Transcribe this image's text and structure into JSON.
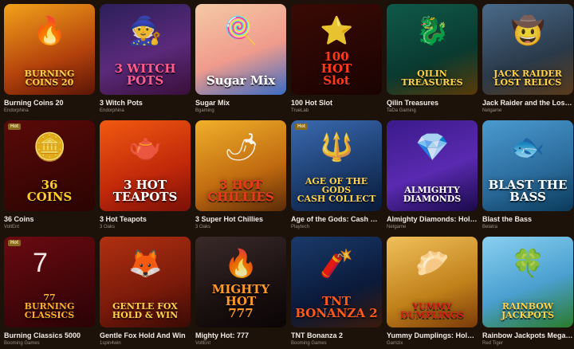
{
  "games": [
    {
      "title": "Burning Coins 20",
      "provider": "Endorphina",
      "art": "BURNING\nCOINS 20",
      "hot": "",
      "bg": "linear-gradient(160deg,#f3a21a,#b4420c 60%,#5a1506)",
      "text_color": "#ffd24a",
      "icon": "fire-icon",
      "glyph": "🔥"
    },
    {
      "title": "3 Witch Pots",
      "provider": "Endorphina",
      "art": "3 WITCH\nPOTS",
      "hot": "",
      "bg": "linear-gradient(160deg,#2b1f5a,#5b2a7a 55%,#3a0f3a)",
      "text_color": "#ff5a8a",
      "icon": "witch-hat-icon",
      "glyph": "🧙"
    },
    {
      "title": "Sugar Mix",
      "provider": "Bgaming",
      "art": "Sugar Mix",
      "hot": "",
      "bg": "linear-gradient(160deg,#f4c9a6,#f09b8c 55%,#3a6cc4)",
      "text_color": "#ffffff",
      "icon": "candy-icon",
      "glyph": "🍭"
    },
    {
      "title": "100 Hot Slot",
      "provider": "TrueLab",
      "art": "100\nHOT\nSlot",
      "hot": "",
      "bg": "linear-gradient(160deg,#3a0a05,#1a0302)",
      "text_color": "#ff3a1a",
      "icon": "star-icon",
      "glyph": "⭐"
    },
    {
      "title": "Qilin Treasures",
      "provider": "TaDa Gaming",
      "art": "QILIN\nTREASURES",
      "hot": "",
      "bg": "linear-gradient(160deg,#0f5a4a,#0a3a30 60%,#5a3a08)",
      "text_color": "#ffd24a",
      "icon": "dragon-icon",
      "glyph": "🐉"
    },
    {
      "title": "Jack Raider and the Lost Relics",
      "provider": "Netgame",
      "art": "JACK RAIDER\nLOST RELICS",
      "hot": "",
      "bg": "linear-gradient(160deg,#4a6a8a,#2a3a4a 60%,#5a3a1a)",
      "text_color": "#ffd24a",
      "icon": "explorer-icon",
      "glyph": "🤠"
    },
    {
      "title": "36 Coins",
      "provider": "VoltEnt",
      "art": "36\nCOINS",
      "hot": "Hot",
      "bg": "linear-gradient(160deg,#5a0a08,#2a0402)",
      "text_color": "#ffcc2a",
      "icon": "coin-icon",
      "glyph": "🪙"
    },
    {
      "title": "3 Hot Teapots",
      "provider": "3 Oaks",
      "art": "3 HOT\nTEAPOTS",
      "hot": "",
      "bg": "linear-gradient(160deg,#f05a10,#c0280a 60%,#7a1008)",
      "text_color": "#ffffff",
      "icon": "teapot-icon",
      "glyph": "🫖"
    },
    {
      "title": "3 Super Hot Chillies",
      "provider": "3 Oaks",
      "art": "3 HOT\nCHILLIES",
      "hot": "",
      "bg": "linear-gradient(160deg,#f0b02a,#c06a10 60%,#5a2a08)",
      "text_color": "#e83a1a",
      "icon": "chili-pepper-icon",
      "glyph": "🌶"
    },
    {
      "title": "Age of the Gods: Cash Collect",
      "provider": "Playtech",
      "art": "AGE OF THE GODS\nCASH COLLECT",
      "hot": "Hot",
      "bg": "linear-gradient(160deg,#3a6ab0,#1a3a6a 60%,#0a1a3a)",
      "text_color": "#ffd24a",
      "icon": "trident-icon",
      "glyph": "🔱"
    },
    {
      "title": "Almighty Diamonds: Hold 'N' Link",
      "provider": "Netgame",
      "art": "ALMIGHTY\nDIAMONDS",
      "hot": "",
      "bg": "linear-gradient(160deg,#3a1a8a,#5a2ab0 55%,#1a0a4a)",
      "text_color": "#ffffff",
      "icon": "diamond-icon",
      "glyph": "💎"
    },
    {
      "title": "Blast the Bass",
      "provider": "Belatra",
      "art": "BLAST THE\nBASS",
      "hot": "",
      "bg": "linear-gradient(160deg,#4a9ad0,#2a6a9a 60%,#0a3a5a)",
      "text_color": "#ffffff",
      "icon": "fish-icon",
      "glyph": "🐟"
    },
    {
      "title": "Burning Classics 5000",
      "provider": "Booming Games",
      "art": "77\nBURNING CLASSICS",
      "hot": "Hot",
      "bg": "linear-gradient(160deg,#6a0a10,#2a0306)",
      "text_color": "#ffb02a",
      "icon": "seven-icon",
      "glyph": "7"
    },
    {
      "title": "Gentle Fox Hold And Win",
      "provider": "1spin4win",
      "art": "GENTLE FOX\nHOLD & WIN",
      "hot": "",
      "bg": "linear-gradient(160deg,#b03010,#7a1a0a 60%,#3a0a05)",
      "text_color": "#ffd24a",
      "icon": "fox-icon",
      "glyph": "🦊"
    },
    {
      "title": "Mighty Hot: 777",
      "provider": "VoltEnt",
      "art": "MIGHTY HOT\n777",
      "hot": "",
      "bg": "linear-gradient(160deg,#3a2a2a,#1a1010 60%,#0a0505)",
      "text_color": "#ff9a2a",
      "icon": "seven-icon",
      "glyph": "🔥"
    },
    {
      "title": "TNT Bonanza 2",
      "provider": "Booming Games",
      "art": "TNT\nBONANZA 2",
      "hot": "",
      "bg": "linear-gradient(160deg,#1a3a6a,#0a1a3a 60%,#3a1a0a)",
      "text_color": "#ff5a1a",
      "icon": "dynamite-icon",
      "glyph": "🧨"
    },
    {
      "title": "Yummy Dumplings: Hold the Spin",
      "provider": "Gamzix",
      "art": "YUMMY\nDUMPLINGS",
      "hot": "",
      "bg": "linear-gradient(160deg,#f0c05a,#c0801a 60%,#7a3a0a)",
      "text_color": "#d0201a",
      "icon": "dumpling-icon",
      "glyph": "🥟"
    },
    {
      "title": "Rainbow Jackpots Megaways",
      "provider": "Red Tiger",
      "art": "RAINBOW\nJACKPOTS",
      "hot": "",
      "bg": "linear-gradient(160deg,#8ad0f0,#4aa0d0 55%,#2a7a2a)",
      "text_color": "#ffd24a",
      "icon": "leprechaun-icon",
      "glyph": "🍀"
    }
  ]
}
